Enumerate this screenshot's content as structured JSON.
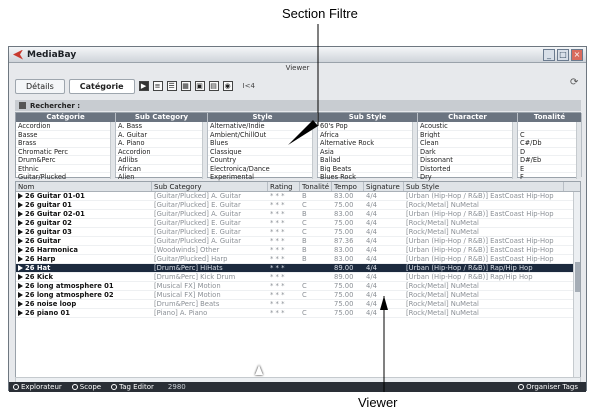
{
  "callouts": {
    "top": "Section Filtre",
    "bottom": "Viewer"
  },
  "window": {
    "title": "MediaBay",
    "view_label": "Viewer"
  },
  "toolbar": {
    "tabs": [
      "Détails",
      "Catégorie"
    ],
    "active_tab": "Catégorie",
    "counter": "I<4"
  },
  "search": {
    "label": "Rechercher :"
  },
  "filters": {
    "columns": [
      {
        "header": "Catégorie",
        "items": [
          "Accordion",
          "Basse",
          "Brass",
          "Chromatic Perc",
          "Drum&Perc",
          "Ethnic",
          "Guitar/Plucked"
        ]
      },
      {
        "header": "Sub Category",
        "items": [
          "A. Bass",
          "A. Guitar",
          "A. Piano",
          "Accordion",
          "Adlibs",
          "African",
          "Alien"
        ]
      },
      {
        "header": "Style",
        "items": [
          "Alternative/Indie",
          "Ambient/ChillOut",
          "Blues",
          "Classique",
          "Country",
          "Electronica/Dance",
          "Experimental"
        ]
      },
      {
        "header": "Sub Style",
        "items": [
          "60's Pop",
          "Africa",
          "Alternative Rock",
          "Asia",
          "Ballad",
          "Big Beats",
          "Blues Rock"
        ]
      },
      {
        "header": "Character",
        "items": [
          "Acoustic",
          "Bright",
          "Clean",
          "Dark",
          "Dissonant",
          "Distorted",
          "Dry"
        ]
      },
      {
        "header": "Tonalité",
        "items": [
          "",
          "C",
          "C#/Db",
          "D",
          "D#/Eb",
          "E",
          "F"
        ]
      }
    ]
  },
  "table": {
    "headers": [
      "Nom",
      "Sub Category",
      "Rating",
      "Tonalité",
      "Tempo",
      "Signature",
      "Sub Style"
    ],
    "rows": [
      {
        "name": "26 Guitar 01-01",
        "sub": "[Guitar/Plucked] A. Guitar",
        "rating": "* * *",
        "key": "B",
        "tempo": "83.00",
        "sig": "4/4",
        "style": "[Urban (Hip-Hop / R&B)] EastCoast Hip-Hop"
      },
      {
        "name": "26 guitar 01",
        "sub": "[Guitar/Plucked] E. Guitar",
        "rating": "* * *",
        "key": "C",
        "tempo": "75.00",
        "sig": "4/4",
        "style": "[Rock/Metal] NuMetal"
      },
      {
        "name": "26 Guitar 02-01",
        "sub": "[Guitar/Plucked] A. Guitar",
        "rating": "* * *",
        "key": "B",
        "tempo": "83.00",
        "sig": "4/4",
        "style": "[Urban (Hip-Hop / R&B)] EastCoast Hip-Hop"
      },
      {
        "name": "26 guitar 02",
        "sub": "[Guitar/Plucked] E. Guitar",
        "rating": "* * *",
        "key": "C",
        "tempo": "75.00",
        "sig": "4/4",
        "style": "[Rock/Metal] NuMetal"
      },
      {
        "name": "26 guitar 03",
        "sub": "[Guitar/Plucked] E. Guitar",
        "rating": "* * *",
        "key": "C",
        "tempo": "75.00",
        "sig": "4/4",
        "style": "[Rock/Metal] NuMetal"
      },
      {
        "name": "26 Guitar",
        "sub": "[Guitar/Plucked] A. Guitar",
        "rating": "* * *",
        "key": "B",
        "tempo": "87.36",
        "sig": "4/4",
        "style": "[Urban (Hip-Hop / R&B)] EastCoast Hip-Hop"
      },
      {
        "name": "26 Harmonica",
        "sub": "[Woodwinds] Other",
        "rating": "* * *",
        "key": "B",
        "tempo": "83.00",
        "sig": "4/4",
        "style": "[Urban (Hip-Hop / R&B)] EastCoast Hip-Hop"
      },
      {
        "name": "26 Harp",
        "sub": "[Guitar/Plucked] Harp",
        "rating": "* * *",
        "key": "B",
        "tempo": "83.00",
        "sig": "4/4",
        "style": "[Urban (Hip-Hop / R&B)] EastCoast Hip-Hop"
      },
      {
        "name": "26 Hat",
        "sub": "[Drum&Perc] HiHats",
        "rating": "* * *",
        "key": "",
        "tempo": "89.00",
        "sig": "4/4",
        "style": "[Urban (Hip-Hop / R&B)] Rap/Hip Hop",
        "selected": true
      },
      {
        "name": "26 Kick",
        "sub": "[Drum&Perc] Kick Drum",
        "rating": "* * *",
        "key": "",
        "tempo": "89.00",
        "sig": "4/4",
        "style": "[Urban (Hip-Hop / R&B)] Rap/Hip Hop"
      },
      {
        "name": "26 long atmosphere 01",
        "sub": "[Musical FX] Motion",
        "rating": "* * *",
        "key": "C",
        "tempo": "75.00",
        "sig": "4/4",
        "style": "[Rock/Metal] NuMetal"
      },
      {
        "name": "26 long atmosphere 02",
        "sub": "[Musical FX] Motion",
        "rating": "* * *",
        "key": "C",
        "tempo": "75.00",
        "sig": "4/4",
        "style": "[Rock/Metal] NuMetal"
      },
      {
        "name": "26 noise loop",
        "sub": "[Drum&Perc] Beats",
        "rating": "* * *",
        "key": "",
        "tempo": "75.00",
        "sig": "4/4",
        "style": "[Rock/Metal] NuMetal"
      },
      {
        "name": "26 piano 01",
        "sub": "[Piano] A. Piano",
        "rating": "* * *",
        "key": "C",
        "tempo": "75.00",
        "sig": "4/4",
        "style": "[Rock/Metal] NuMetal"
      }
    ]
  },
  "status": {
    "explorer": "Explorateur",
    "scope": "Scope",
    "tag_editor": "Tag Editor",
    "count": "2980",
    "organize": "Organiser Tags"
  }
}
